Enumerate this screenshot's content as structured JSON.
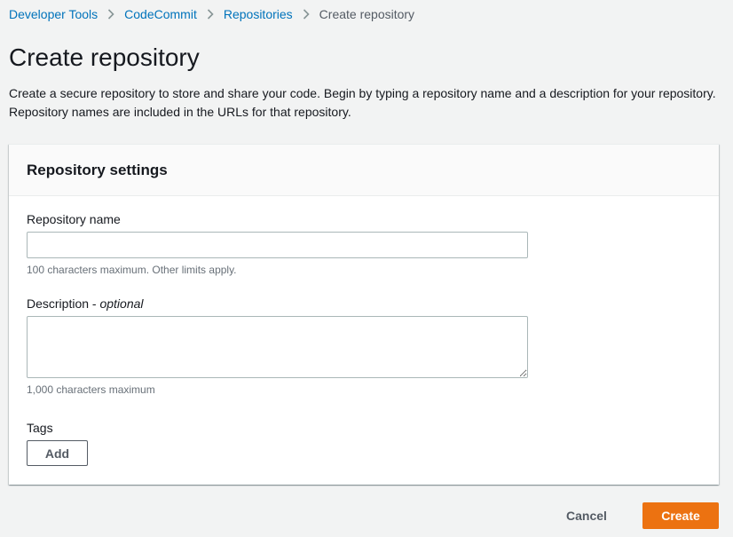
{
  "breadcrumb": {
    "items": [
      {
        "label": "Developer Tools"
      },
      {
        "label": "CodeCommit"
      },
      {
        "label": "Repositories"
      },
      {
        "label": "Create repository"
      }
    ],
    "separator_icon": "chevron-right-icon"
  },
  "page": {
    "title": "Create repository",
    "description": "Create a secure repository to store and share your code. Begin by typing a repository name and a description for your repository. Repository names are included in the URLs for that repository."
  },
  "settings": {
    "title": "Repository settings",
    "name_field": {
      "label": "Repository name",
      "value": "",
      "placeholder": "",
      "hint": "100 characters maximum. Other limits apply."
    },
    "description_field": {
      "label": "Description - ",
      "label_optional": "optional",
      "value": "",
      "hint": "1,000 characters maximum"
    },
    "tags": {
      "label": "Tags",
      "add_label": "Add"
    }
  },
  "actions": {
    "cancel_label": "Cancel",
    "create_label": "Create"
  },
  "colors": {
    "background": "#f2f3f3",
    "link": "#0073bb",
    "primary_button": "#ec7211",
    "text": "#16191f",
    "secondary_text": "#687078"
  }
}
